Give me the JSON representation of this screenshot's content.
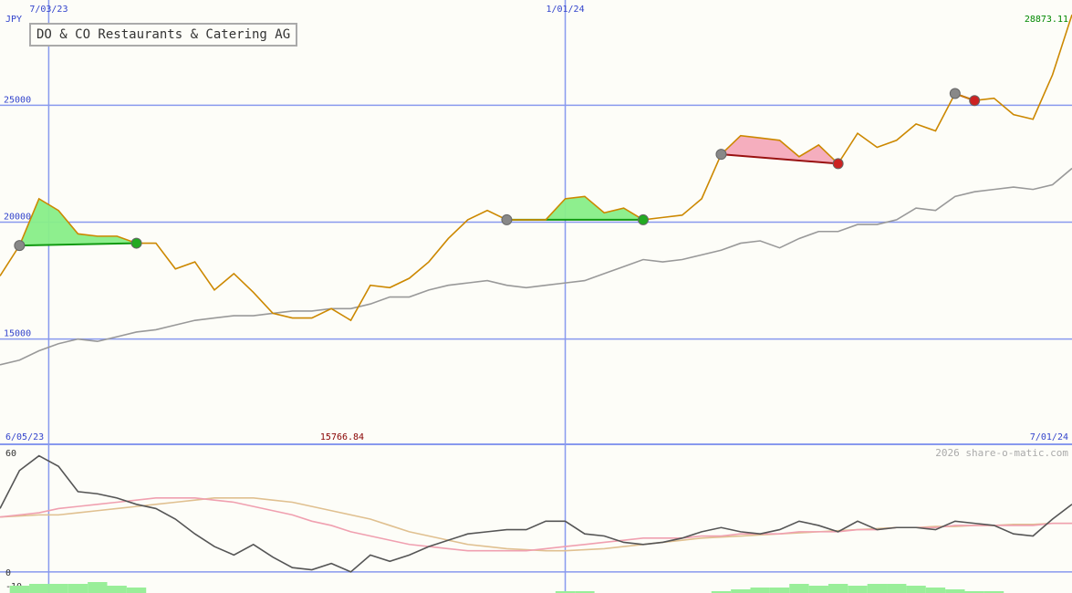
{
  "chart_data": [
    {
      "type": "line",
      "title": "DO & CO Restaurants & Catering AG",
      "currency": "JPY",
      "ylim": [
        10500,
        29500
      ],
      "y_ticks": [
        15000,
        20000,
        25000
      ],
      "y_tick_labels": [
        "15000",
        "20000",
        "25000"
      ],
      "x_ticks": [
        {
          "label": "7/03/23",
          "index": 2.5
        },
        {
          "label": "1/01/24",
          "index": 29
        }
      ],
      "start_label": "6/05/23",
      "end_label": "7/01/24",
      "last_value_label": "28873.11",
      "low_value_label": "15766.84",
      "series": [
        {
          "name": "price",
          "color": "#cc8800",
          "values": [
            17700,
            19000,
            21000,
            20500,
            19500,
            19400,
            19400,
            19100,
            19100,
            18000,
            18300,
            17100,
            17800,
            17000,
            16100,
            15900,
            15900,
            16300,
            15800,
            17300,
            17200,
            17600,
            18300,
            19300,
            20100,
            20500,
            20100,
            20100,
            20100,
            21000,
            21100,
            20400,
            20600,
            20100,
            20200,
            20300,
            21000,
            22900,
            23700,
            23600,
            23500,
            22800,
            23300,
            22500,
            23800,
            23200,
            23500,
            24200,
            23900,
            25500,
            25200,
            25300,
            24600,
            24400,
            26300,
            28873
          ]
        },
        {
          "name": "moving-average",
          "color": "#999999",
          "values": [
            13900,
            14100,
            14500,
            14800,
            15000,
            14900,
            15100,
            15300,
            15400,
            15600,
            15800,
            15900,
            16000,
            16000,
            16100,
            16200,
            16200,
            16300,
            16300,
            16500,
            16800,
            16800,
            17100,
            17300,
            17400,
            17500,
            17300,
            17200,
            17300,
            17400,
            17500,
            17800,
            18100,
            18400,
            18300,
            18400,
            18600,
            18800,
            19100,
            19200,
            18900,
            19300,
            19600,
            19600,
            19900,
            19900,
            20100,
            20600,
            20500,
            21100,
            21300,
            21400,
            21500,
            21400,
            21600,
            22300
          ]
        }
      ],
      "trades": [
        {
          "type": "win",
          "start": 1,
          "end": 7
        },
        {
          "type": "win",
          "start": 26,
          "end": 33
        },
        {
          "type": "loss",
          "start": 37,
          "end": 43
        },
        {
          "type": "loss",
          "start": 49,
          "end": 50
        }
      ]
    },
    {
      "type": "line",
      "ylim": [
        -10,
        60
      ],
      "y_ticks": [
        60,
        0,
        -10
      ],
      "y_tick_labels": [
        "60",
        "0",
        "-10"
      ],
      "watermark": "2026 share-o-matic.com",
      "series": [
        {
          "name": "oscillator",
          "color": "#555555",
          "values": [
            30,
            48,
            55,
            50,
            38,
            37,
            35,
            32,
            30,
            25,
            18,
            12,
            8,
            13,
            7,
            2,
            1,
            4,
            0,
            8,
            5,
            8,
            12,
            15,
            18,
            19,
            20,
            20,
            24,
            24,
            18,
            17,
            14,
            13,
            14,
            16,
            19,
            21,
            19,
            18,
            20,
            24,
            22,
            19,
            24,
            20,
            21,
            21,
            20,
            24,
            23,
            22,
            18,
            17,
            25,
            32
          ]
        },
        {
          "name": "signal-line",
          "color": "#f0a0b0",
          "values": [
            26,
            27,
            28,
            30,
            31,
            32,
            33,
            34,
            35,
            35,
            35,
            34,
            33,
            31,
            29,
            27,
            24,
            22,
            19,
            17,
            15,
            13,
            12,
            11,
            10,
            10,
            10,
            10,
            11,
            12,
            13,
            14,
            15,
            16,
            16,
            16,
            17,
            17,
            18,
            18,
            18,
            19,
            19,
            19,
            20,
            20,
            21,
            21,
            21,
            22,
            22,
            22,
            22,
            22,
            23,
            23
          ]
        },
        {
          "name": "slow-line",
          "color": "#e0c090",
          "values": [
            26,
            26.5,
            27,
            27,
            28,
            29,
            30,
            31,
            32,
            33,
            34,
            35,
            35,
            35,
            34,
            33,
            31,
            29,
            27,
            25,
            22,
            19,
            17,
            15,
            13,
            12,
            11,
            10.5,
            10,
            10,
            10.5,
            11,
            12,
            13,
            14,
            15,
            16,
            16.5,
            17,
            17.5,
            18,
            18.5,
            19,
            19.5,
            20,
            20.5,
            21,
            21,
            21.5,
            21.5,
            22,
            22,
            22.5,
            22.5,
            23,
            23
          ]
        }
      ],
      "histogram": {
        "color": "#99ee99",
        "values": [
          0,
          4,
          5,
          5,
          5,
          6,
          4,
          3,
          0,
          0,
          0,
          0,
          0,
          0,
          0,
          0,
          0,
          0,
          0,
          0,
          0,
          0,
          0,
          0,
          0,
          0,
          0,
          0,
          0,
          1,
          1,
          0,
          0,
          0,
          0,
          0,
          0,
          1,
          2,
          3,
          3,
          5,
          4,
          5,
          4,
          5,
          5,
          4,
          3,
          2,
          1,
          1,
          0,
          0,
          0,
          0
        ]
      }
    }
  ]
}
